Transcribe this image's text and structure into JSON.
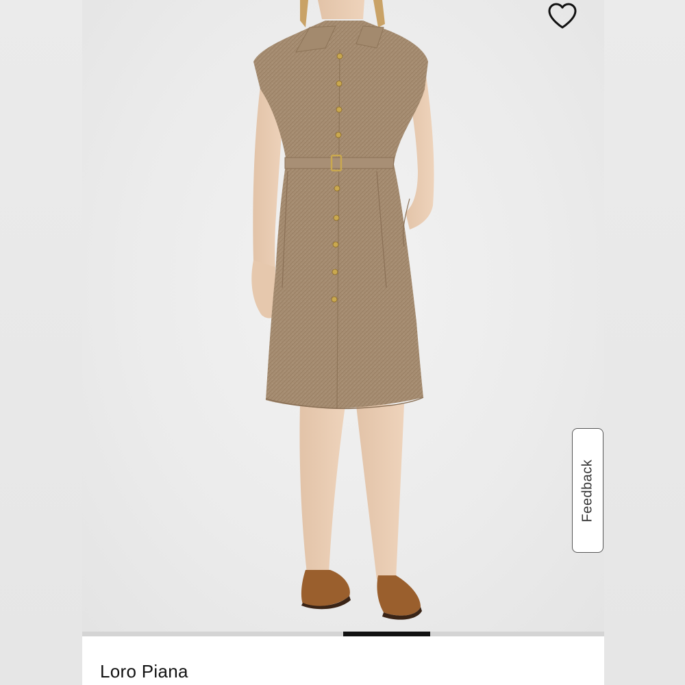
{
  "product": {
    "brand": "Loro Piana",
    "image_alt": "Model wearing a belted short-sleeve linen shirt dress with brown loafers"
  },
  "wishlist": {
    "icon": "heart-outline-icon"
  },
  "feedback": {
    "label": "Feedback"
  },
  "carousel": {
    "total_slides": 6,
    "active_slide": 4
  },
  "colors": {
    "dress": "#a58c70",
    "shoes": "#9a5f2d",
    "background": "#ececec",
    "indicator_active": "#111111",
    "indicator_track": "#d4d4d4"
  }
}
